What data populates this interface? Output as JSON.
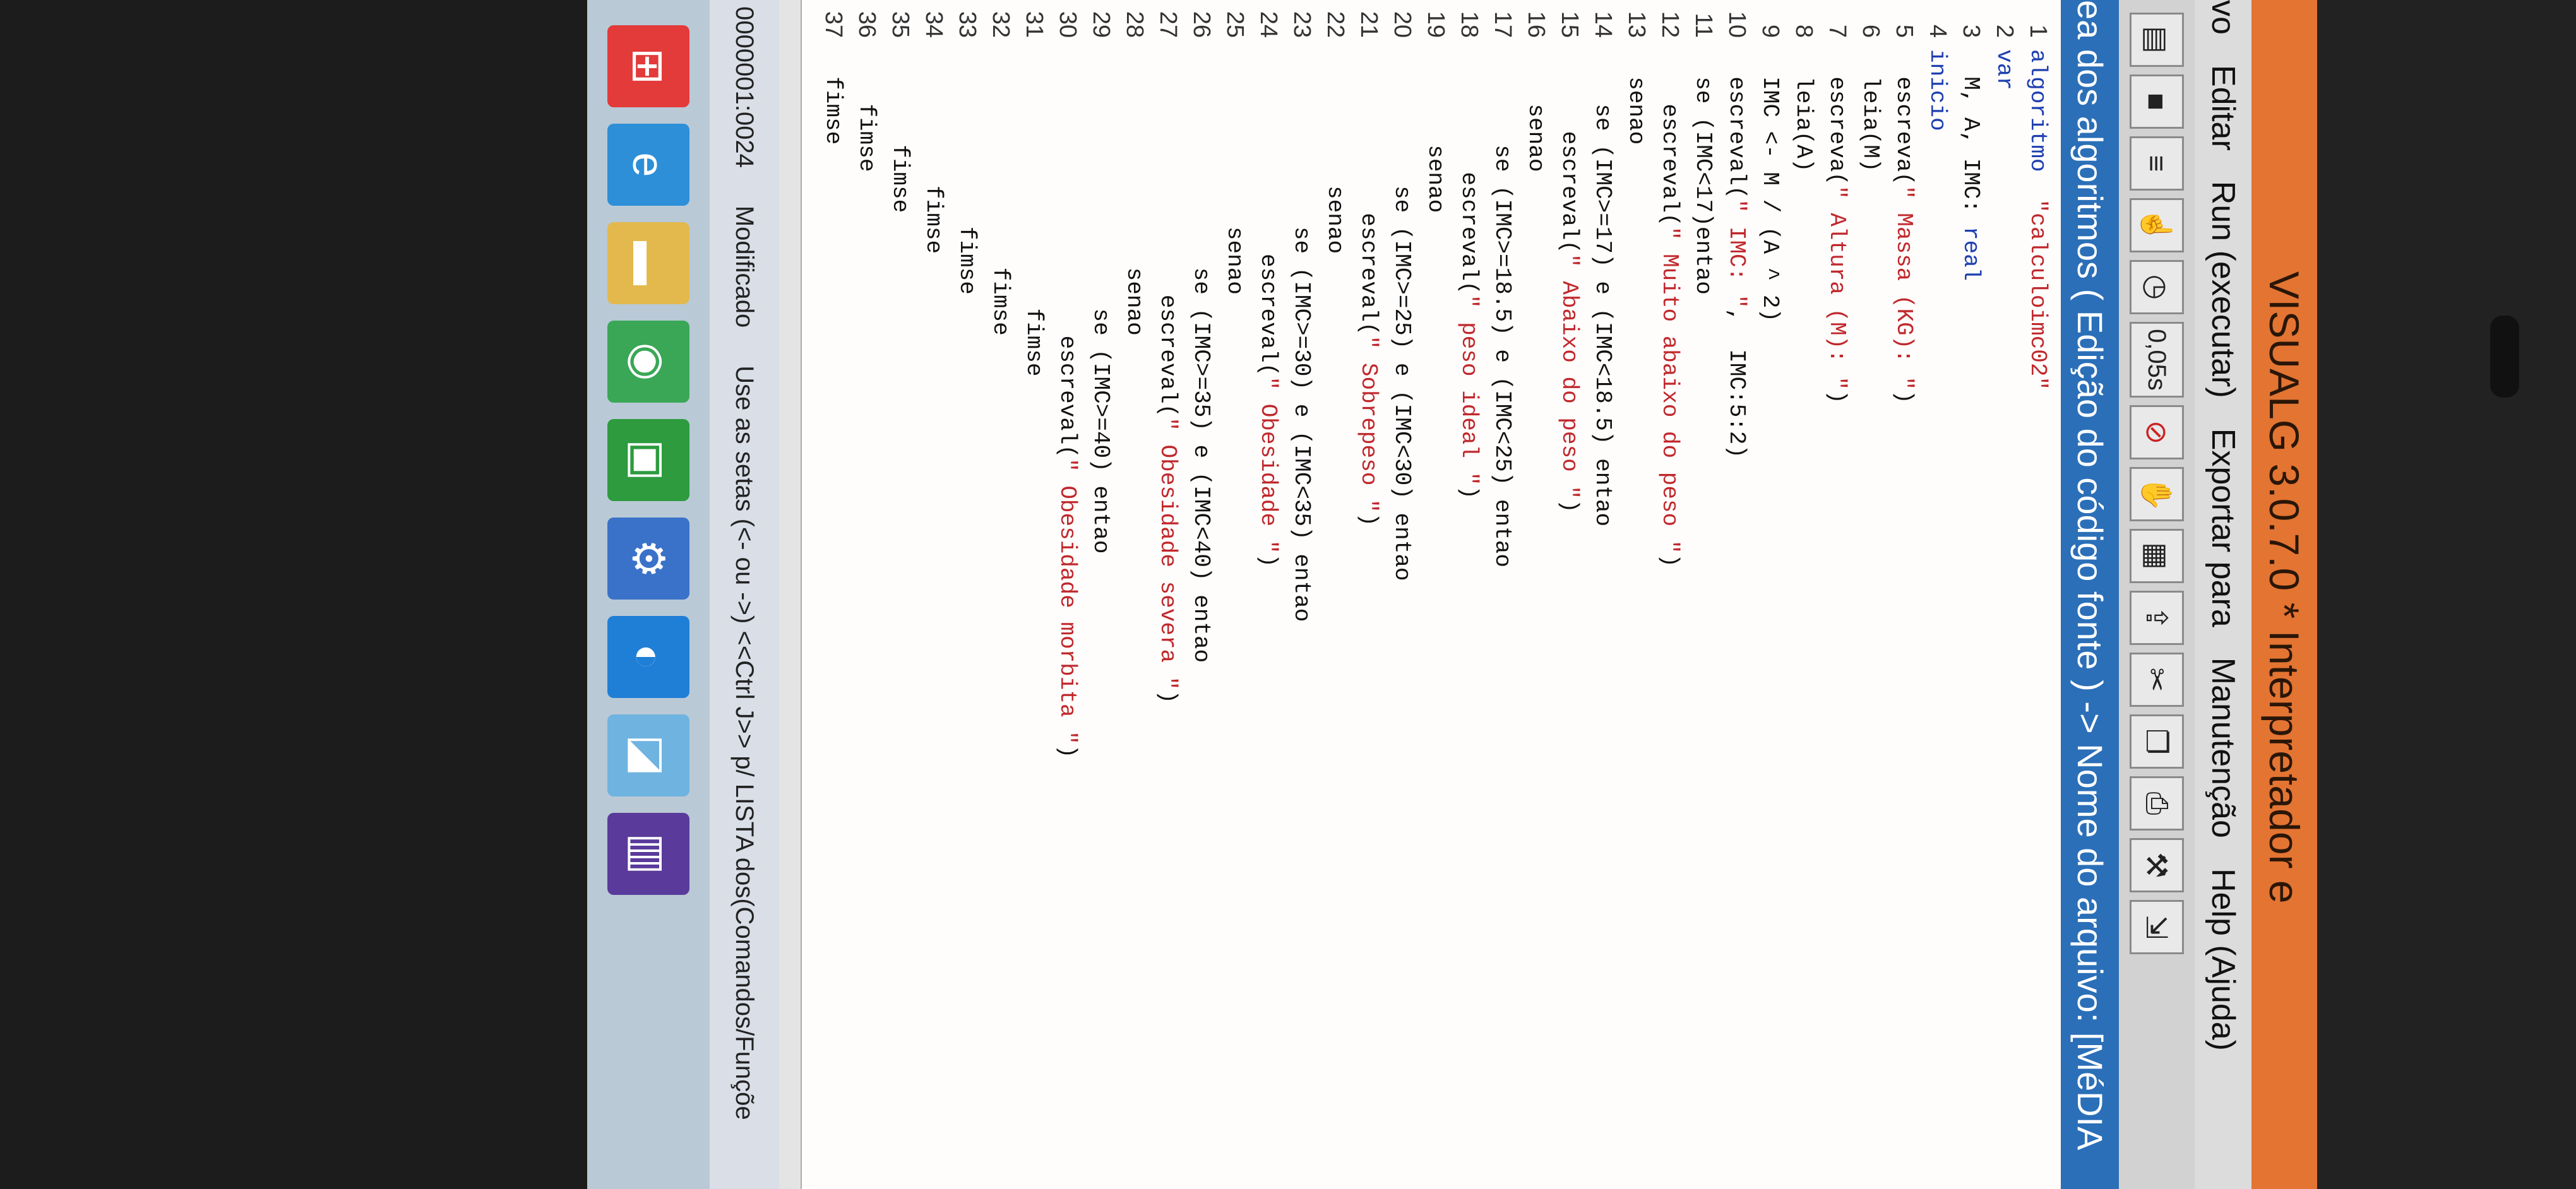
{
  "window": {
    "title": "VISUALG 3.0.7.0 * Interpretador e"
  },
  "menu": [
    "vo",
    "Editar",
    "Run (executar)",
    "Exportar para",
    "Manutenção",
    "Help (Ajuda)"
  ],
  "toolbar": {
    "speed": "0,05s",
    "icons": [
      "new-icon",
      "save-icon",
      "step-icon",
      "pointer-icon",
      "timer-icon",
      "stop-icon",
      "hand-icon",
      "chart-icon",
      "upload-icon",
      "scissors-icon",
      "copy-icon",
      "print-icon",
      "tools-icon",
      "exit-icon"
    ]
  },
  "editor": {
    "header": "ea dos algoritmos ( Edição do código fonte ) -> Nome do arquivo: [MéDIA"
  },
  "code": [
    {
      "n": "1",
      "t": [
        [
          "kw",
          "algoritmo"
        ],
        [
          "",
          "  "
        ],
        [
          "str",
          "\"calculoimc02\""
        ]
      ]
    },
    {
      "n": "2",
      "t": [
        [
          "kw",
          "var"
        ]
      ]
    },
    {
      "n": "3",
      "t": [
        [
          "",
          "  M, A, IMC: "
        ],
        [
          "kw",
          "real"
        ]
      ]
    },
    {
      "n": "4",
      "t": [
        [
          "kw",
          "inicio"
        ]
      ]
    },
    {
      "n": "5",
      "t": [
        [
          "",
          "  escreva("
        ],
        [
          "str",
          "\" Massa (KG): \""
        ],
        [
          "",
          ")"
        ]
      ]
    },
    {
      "n": "6",
      "t": [
        [
          "",
          "  leia(M)"
        ]
      ]
    },
    {
      "n": "7",
      "t": [
        [
          "",
          "  escreva("
        ],
        [
          "str",
          "\" Altura (M): \""
        ],
        [
          "",
          ")"
        ]
      ]
    },
    {
      "n": "8",
      "t": [
        [
          "",
          "  leia(A)"
        ]
      ]
    },
    {
      "n": "9",
      "t": [
        [
          "",
          "  IMC <- M / (A ^ 2)"
        ]
      ]
    },
    {
      "n": "10",
      "t": [
        [
          "",
          "  escreval("
        ],
        [
          "str",
          "\" IMC: \""
        ],
        [
          "",
          ",  IMC:5:2)"
        ]
      ]
    },
    {
      "n": "11",
      "t": [
        [
          "",
          "  se (IMC<17)entao"
        ]
      ]
    },
    {
      "n": "12",
      "t": [
        [
          "",
          "    escreval("
        ],
        [
          "str",
          "\" Muito abaixo do peso \""
        ],
        [
          "",
          ")"
        ]
      ]
    },
    {
      "n": "13",
      "t": [
        [
          "",
          "  senao"
        ]
      ]
    },
    {
      "n": "14",
      "t": [
        [
          "",
          "    se (IMC>=17) e (IMC<18.5) entao"
        ]
      ]
    },
    {
      "n": "15",
      "t": [
        [
          "",
          "      escreval("
        ],
        [
          "str",
          "\" Abaixo do peso \""
        ],
        [
          "",
          ")"
        ]
      ]
    },
    {
      "n": "16",
      "t": [
        [
          "",
          "    senao"
        ]
      ]
    },
    {
      "n": "17",
      "t": [
        [
          "",
          "       se (IMC>=18.5) e (IMC<25) entao"
        ]
      ]
    },
    {
      "n": "18",
      "t": [
        [
          "",
          "         escreval("
        ],
        [
          "str",
          "\" peso ideal \""
        ],
        [
          "",
          ")"
        ]
      ]
    },
    {
      "n": "19",
      "t": [
        [
          "",
          "       senao"
        ]
      ]
    },
    {
      "n": "20",
      "t": [
        [
          "",
          "          se (IMC>=25) e (IMC<30) entao"
        ]
      ]
    },
    {
      "n": "21",
      "t": [
        [
          "",
          "            escreval("
        ],
        [
          "str",
          "\" Sobrepeso \""
        ],
        [
          "",
          ")"
        ]
      ]
    },
    {
      "n": "22",
      "t": [
        [
          "",
          "          senao"
        ]
      ]
    },
    {
      "n": "23",
      "t": [
        [
          "",
          "             se (IMC>=30) e (IMC<35) entao"
        ]
      ]
    },
    {
      "n": "24",
      "t": [
        [
          "",
          "               escreval("
        ],
        [
          "str",
          "\" Obesidade \""
        ],
        [
          "",
          ")"
        ]
      ]
    },
    {
      "n": "25",
      "t": [
        [
          "",
          "             senao"
        ]
      ]
    },
    {
      "n": "26",
      "t": [
        [
          "",
          "                se (IMC>=35) e (IMC<40) entao"
        ]
      ]
    },
    {
      "n": "27",
      "t": [
        [
          "",
          "                  escreval("
        ],
        [
          "str",
          "\" Obesidade severa \""
        ],
        [
          "",
          ")"
        ]
      ]
    },
    {
      "n": "28",
      "t": [
        [
          "",
          "                senao"
        ]
      ]
    },
    {
      "n": "29",
      "t": [
        [
          "",
          "                   se (IMC>=40) entao"
        ]
      ]
    },
    {
      "n": "30",
      "t": [
        [
          "",
          "                     escreval("
        ],
        [
          "str",
          "\" Obesidade morbita \""
        ],
        [
          "",
          ")"
        ]
      ]
    },
    {
      "n": "31",
      "t": [
        [
          "",
          "                   fimse"
        ]
      ]
    },
    {
      "n": "32",
      "t": [
        [
          "",
          "                fimse"
        ]
      ]
    },
    {
      "n": "33",
      "t": [
        [
          "",
          "             fimse"
        ]
      ]
    },
    {
      "n": "34",
      "t": [
        [
          "",
          "          fimse"
        ]
      ]
    },
    {
      "n": "35",
      "t": [
        [
          "",
          "       fimse"
        ]
      ]
    },
    {
      "n": "36",
      "t": [
        [
          "",
          "    fimse"
        ]
      ]
    },
    {
      "n": "37",
      "t": [
        [
          "",
          "  fimse"
        ]
      ]
    }
  ],
  "status": {
    "position": "0000001:0024",
    "state": "Modificado",
    "hint": "Use as setas (<- ou ->) <<Ctrl J>> p/ LISTA dos(Comandos/Funçõe"
  },
  "taskbar": [
    "start-icon",
    "ie-icon",
    "folder-icon",
    "chrome-icon",
    "store-icon",
    "settings-icon",
    "edge-icon",
    "files-icon",
    "books-icon"
  ],
  "colors": {
    "titlebar": "#e37432",
    "editor_header": "#2b6fb8",
    "keyword": "#1d3fb0",
    "string": "#c0282c"
  }
}
